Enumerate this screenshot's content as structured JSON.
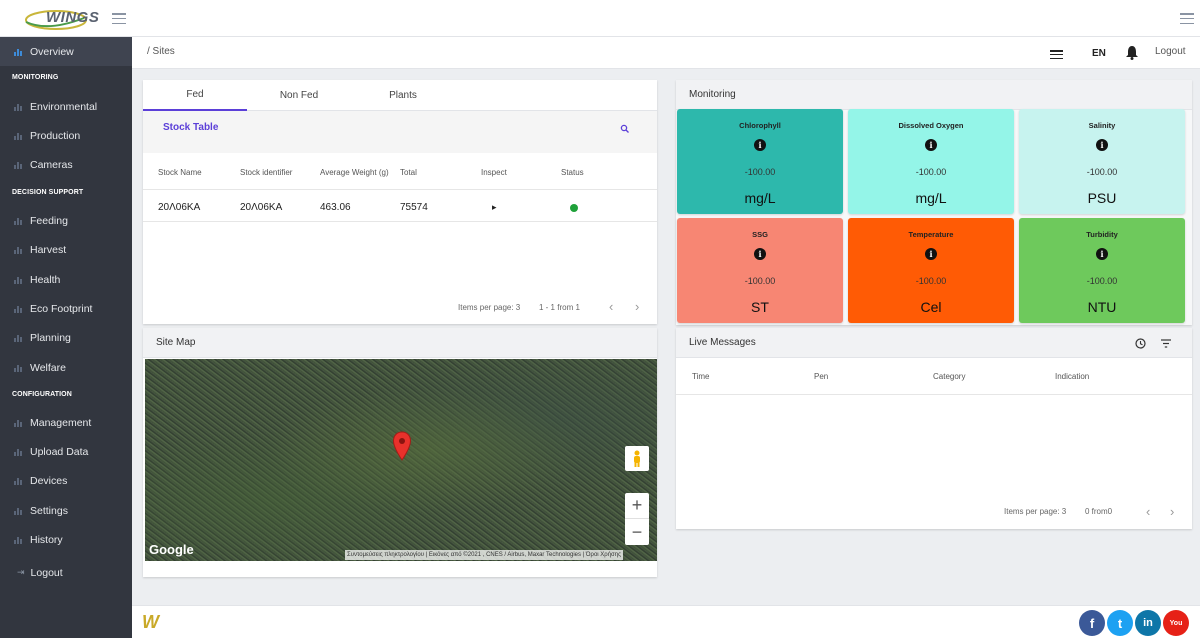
{
  "header": {
    "brand": "WINGS",
    "breadcrumb": "/  Sites",
    "language": "EN",
    "logout_label": "Logout"
  },
  "sidebar": {
    "items": [
      {
        "label": "Overview"
      },
      {
        "label": "Environmental"
      },
      {
        "label": "Production"
      },
      {
        "label": "Cameras"
      },
      {
        "label": "Feeding"
      },
      {
        "label": "Harvest"
      },
      {
        "label": "Health"
      },
      {
        "label": "Eco Footprint"
      },
      {
        "label": "Planning"
      },
      {
        "label": "Welfare"
      },
      {
        "label": "Management"
      },
      {
        "label": "Upload Data"
      },
      {
        "label": "Devices"
      },
      {
        "label": "Settings"
      },
      {
        "label": "History"
      }
    ],
    "sections": [
      "MONITORING",
      "DECISION SUPPORT",
      "CONFIGURATION"
    ],
    "logout_label": "Logout"
  },
  "stock": {
    "tabs": [
      "Fed",
      "Non Fed",
      "Plants"
    ],
    "active_tab": "Fed",
    "title": "Stock Table",
    "columns": [
      "Stock Name",
      "Stock identifier",
      "Average Weight (g)",
      "Total",
      "Inspect",
      "Status"
    ],
    "rows": [
      {
        "name": "20Λ06KA",
        "identifier": "20Λ06KA",
        "avg_weight": "463.06",
        "total": "75574",
        "inspect": "▸",
        "status_color": "#1fa13a"
      }
    ],
    "pager": {
      "items_per_page": "Items per page: 3",
      "range": "1 - 1 from 1"
    }
  },
  "site_map": {
    "title": "Site Map",
    "google_label": "Google",
    "attribution": "Συντομεύσεις πληκτρολογίου  |  Εικόνες από ©2021 , CNES / Airbus, Maxar Technologies  |  Όροι Χρήσης",
    "zoom_in": "+",
    "zoom_out": "−"
  },
  "monitoring": {
    "title": "Monitoring",
    "tiles": [
      {
        "title": "Chlorophyll",
        "value": "-100.00",
        "unit": "mg/L",
        "color": "#2db8ac"
      },
      {
        "title": "Dissolved Oxygen",
        "value": "-100.00",
        "unit": "mg/L",
        "color": "#94f5e8"
      },
      {
        "title": "Salinity",
        "value": "-100.00",
        "unit": "PSU",
        "color": "#c7f3ef"
      },
      {
        "title": "SSG",
        "value": "-100.00",
        "unit": "ST",
        "color": "#f78673"
      },
      {
        "title": "Temperature",
        "value": "-100.00",
        "unit": "Cel",
        "color": "#ff5b05"
      },
      {
        "title": "Turbidity",
        "value": "-100.00",
        "unit": "NTU",
        "color": "#6ec95c"
      }
    ]
  },
  "live_messages": {
    "title": "Live Messages",
    "columns": [
      "Time",
      "Pen",
      "Category",
      "Indication"
    ],
    "pager": {
      "items_per_page": "Items per page: 3",
      "range": "0 from0"
    }
  },
  "footer": {
    "logo": "W",
    "social": [
      {
        "name": "facebook",
        "glyph": "f",
        "color": "#3b5998"
      },
      {
        "name": "twitter",
        "glyph": "t",
        "color": "#1da1f2"
      },
      {
        "name": "linkedin",
        "glyph": "in",
        "color": "#0e76a8"
      },
      {
        "name": "youtube",
        "glyph": "You",
        "color": "#e62117"
      }
    ]
  }
}
